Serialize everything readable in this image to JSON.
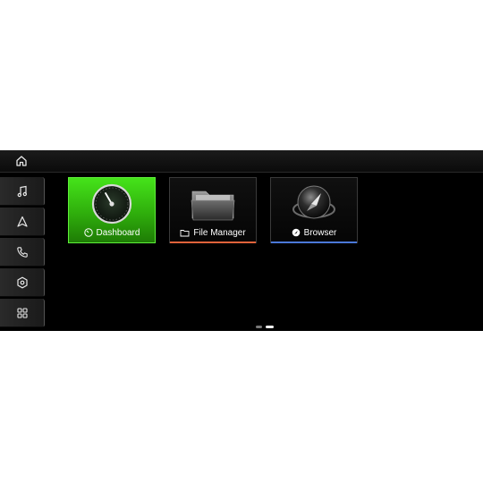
{
  "sidebar": {
    "items": [
      {
        "icon": "music-note-icon"
      },
      {
        "icon": "navigation-arrow-icon"
      },
      {
        "icon": "phone-icon"
      },
      {
        "icon": "settings-hexagon-icon"
      },
      {
        "icon": "apps-grid-icon"
      }
    ]
  },
  "topbar": {
    "icon": "home-icon"
  },
  "apps": [
    {
      "label": "Dashboard",
      "icon": "speedometer-icon",
      "active": true
    },
    {
      "label": "File Manager",
      "icon": "folder-icon",
      "active": false,
      "accent": "#e0623a"
    },
    {
      "label": "Browser",
      "icon": "compass-icon",
      "active": false,
      "accent": "#4a78d8"
    }
  ],
  "pager": {
    "pages": 2,
    "current": 2
  },
  "colors": {
    "active_tile": "#3fd414",
    "file_manager_accent": "#e0623a",
    "browser_accent": "#4a78d8"
  }
}
